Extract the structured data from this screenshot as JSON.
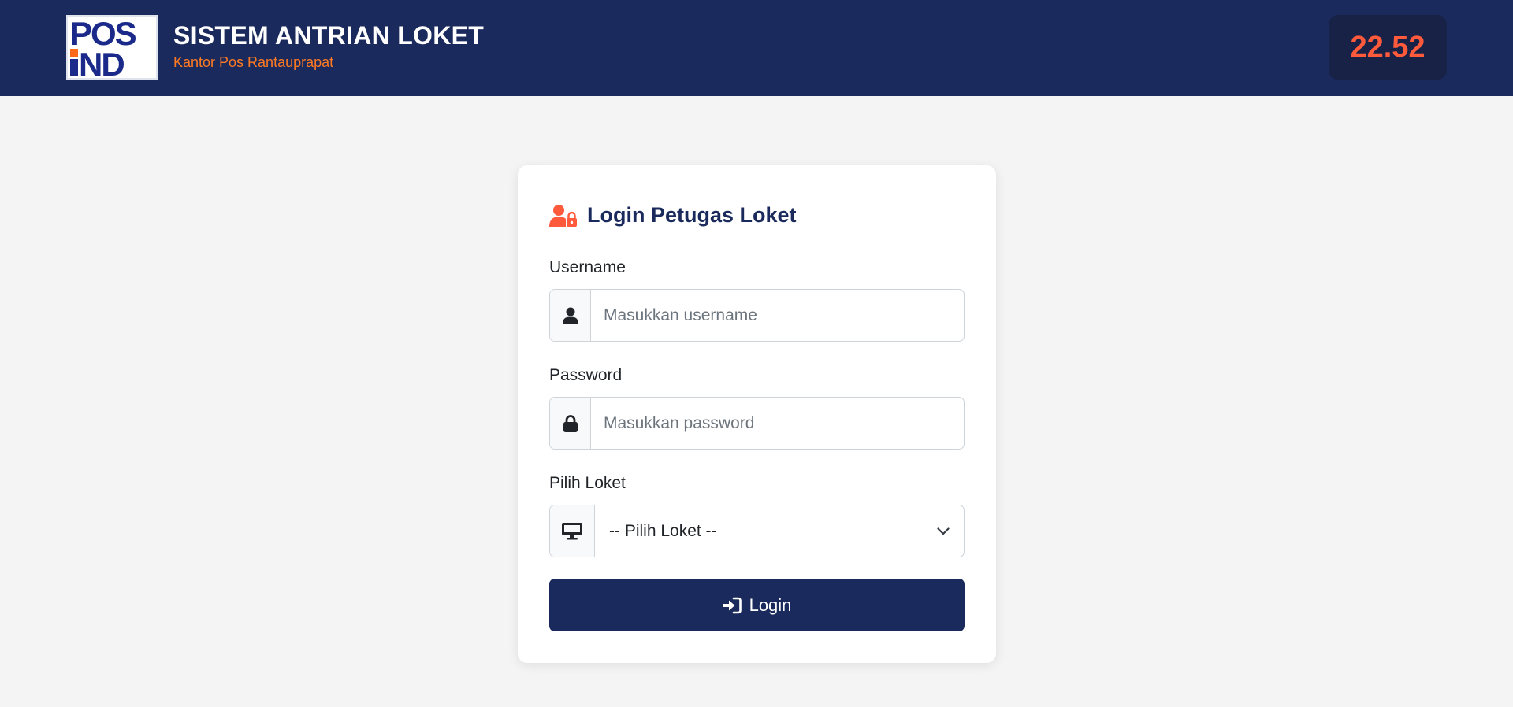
{
  "header": {
    "title": "SISTEM ANTRIAN LOKET",
    "subtitle": "Kantor Pos Rantauprapat",
    "clock": "22.52",
    "logo_text": "POS IND"
  },
  "login": {
    "title": "Login Petugas Loket",
    "title_icon": "user-lock-icon",
    "username_label": "Username",
    "username_placeholder": "Masukkan username",
    "username_value": "",
    "username_icon": "user-icon",
    "password_label": "Password",
    "password_placeholder": "Masukkan password",
    "password_value": "",
    "password_icon": "lock-icon",
    "loket_label": "Pilih Loket",
    "loket_selected": "-- Pilih Loket --",
    "loket_icon": "desktop-icon",
    "button_label": "Login",
    "button_icon": "sign-in-icon"
  },
  "colors": {
    "header_bg": "#1b2a5c",
    "accent": "#ff7a22",
    "clock_text": "#ff5a3c",
    "button_bg": "#1b2a5c",
    "page_bg": "#f4f4f4"
  }
}
